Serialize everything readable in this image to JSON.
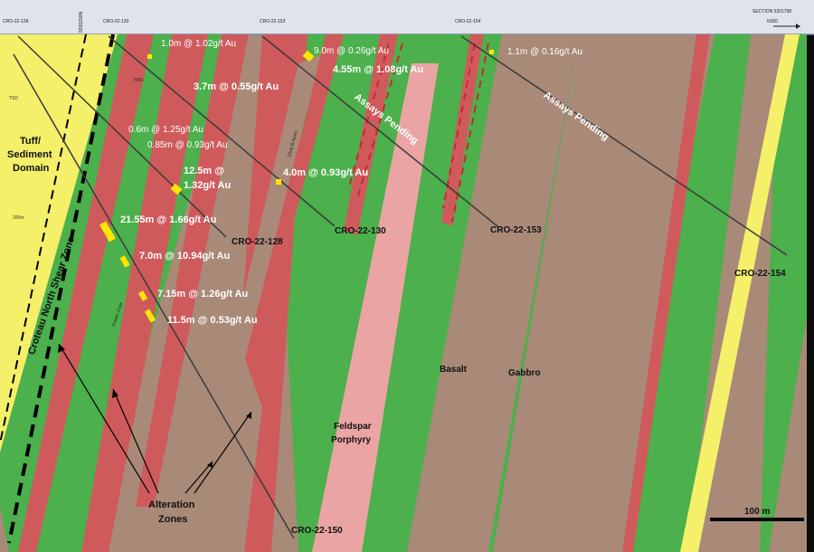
{
  "section": {
    "title": "SECTION 5301758",
    "orientation": "N360",
    "grid_left": "5536200N"
  },
  "collar_labels": {
    "c128": "CRO-22-128",
    "c130": "CRO-22-130",
    "c153": "CRO-22-153",
    "c154": "CRO-22-154",
    "c128b": "CRO-22-128"
  },
  "domains": {
    "tuff": "Tuff/\nSediment\nDomain",
    "tuff_line1": "Tuff/",
    "tuff_line2": "Sediment",
    "tuff_line3": "Domain",
    "shear": "Croteau North Shear Zone",
    "tsd": "TSD",
    "nbd": "NBD"
  },
  "intercepts": {
    "i1": "1.0m @ 1.02g/t Au",
    "i2": "9.0m @ 0.26g/t Au",
    "i3": "4.55m @ 1.08g/t Au",
    "i4": "1.1m @ 0.16g/t Au",
    "i5": "3.7m @ 0.55g/t Au",
    "i6": "0.6m @ 1.25g/t Au",
    "i7": "0.85m @ 0.93g/t Au",
    "i8a": "12.5m @",
    "i8b": "1.32g/t Au",
    "i9": "4.0m @ 0.93g/t Au",
    "i10": "21.55m @ 1.66g/t Au",
    "i11": "7.0m @ 10.94g/t Au",
    "i12": "7.15m @ 1.26g/t Au",
    "i13": "11.5m @ 0.53g/t Au"
  },
  "pending": {
    "p1": "Assays Pending",
    "p2": "Assays Pending"
  },
  "holes": {
    "h128": "CRO-22-128",
    "h130": "CRO-22-130",
    "h153": "CRO-22-153",
    "h154": "CRO-22-154",
    "h150": "CRO-22-150"
  },
  "lithology": {
    "basalt": "Basalt",
    "gabbro": "Gabbro",
    "feldspar1": "Feldspar",
    "feldspar2": "Porphyry",
    "alteration1": "Alteration",
    "alteration2": "Zones",
    "zone_label": "Zone B-North",
    "zone_label2": "Kinetic Zone"
  },
  "scale": {
    "label": "100 m"
  },
  "elevation_tick": "200m",
  "colors": {
    "background": "#0b0b0b",
    "basalt_green": "#4cb04c",
    "gabbro_brown": "#a98a78",
    "alteration_red": "#cf5a5c",
    "porphyry_pink": "#eaa0a0",
    "tuff_yellow": "#f7f26a",
    "intercept_yellow": "#ffe600",
    "hole_trace": "#3a3a3a",
    "header_band": "#d9dde6"
  }
}
